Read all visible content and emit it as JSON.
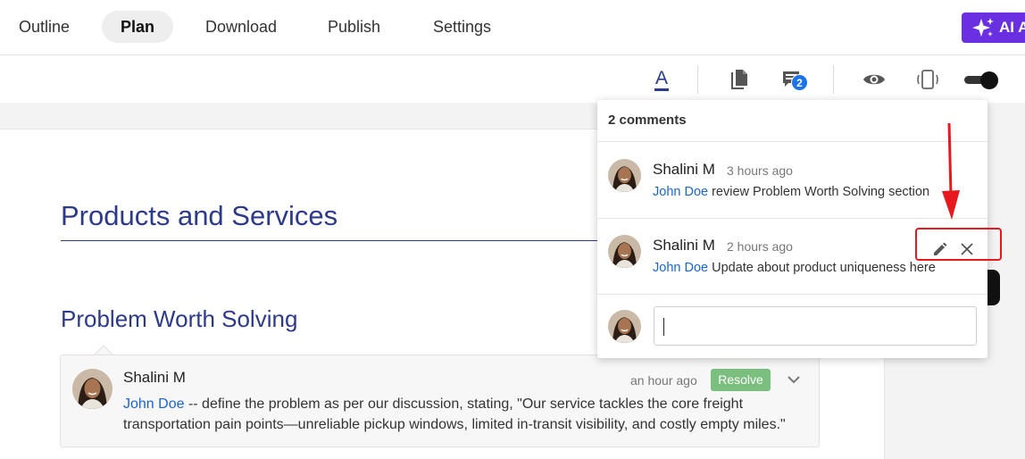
{
  "nav": {
    "tabs": [
      {
        "label": "Outline"
      },
      {
        "label": "Plan"
      },
      {
        "label": "Download"
      },
      {
        "label": "Publish"
      },
      {
        "label": "Settings"
      }
    ],
    "active_tab": "Plan",
    "ai_button_label": "AI A"
  },
  "toolbar": {
    "font_icon_label": "A",
    "comments_badge": "2",
    "icons": [
      "font-color-icon",
      "document-icon",
      "comments-icon",
      "eye-icon",
      "device-preview-icon",
      "toggle-switch"
    ]
  },
  "document": {
    "heading1": "Products and Services",
    "heading2": "Problem Worth Solving"
  },
  "inline_comment": {
    "author": "Shalini M",
    "time": "an hour ago",
    "resolve_label": "Resolve",
    "mention": "John Doe",
    "text_line1": " -- define the problem as per our discussion, stating, \"Our service tackles the core freight",
    "text_line2": "transportation pain points—unreliable pickup windows, limited in-transit visibility, and costly empty miles.\""
  },
  "comments_popup": {
    "header": "2 comments",
    "comments": [
      {
        "author": "Shalini M",
        "time": "3 hours ago",
        "mention": "John Doe",
        "text": " review Problem Worth Solving section"
      },
      {
        "author": "Shalini M",
        "time": "2 hours ago",
        "mention": "John Doe",
        "text": " Update about product uniqueness here"
      }
    ],
    "reply_placeholder": ""
  },
  "colors": {
    "accent_blue": "#2d3a8c",
    "mention_blue": "#1a64d4",
    "resolve_green": "#7bbf7f",
    "ai_purple": "#6a2fe0",
    "annotation_red": "#e8191e",
    "badge_blue": "#1a73e8"
  }
}
